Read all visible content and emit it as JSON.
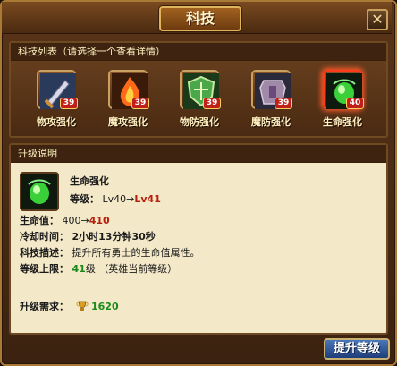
{
  "window": {
    "title": "科技",
    "close_label": "✕"
  },
  "tech_list": {
    "header": "科技列表（请选择一个查看详情）",
    "items": [
      {
        "label": "物攻强化",
        "level": "39",
        "icon": "sword-icon"
      },
      {
        "label": "魔攻强化",
        "level": "39",
        "icon": "fire-icon"
      },
      {
        "label": "物防强化",
        "level": "39",
        "icon": "shield-icon"
      },
      {
        "label": "魔防强化",
        "level": "39",
        "icon": "armor-icon"
      },
      {
        "label": "生命强化",
        "level": "40",
        "icon": "life-orb-icon"
      }
    ]
  },
  "detail": {
    "header": "升级说明",
    "name": "生命强化",
    "level_label": "等级：",
    "level_from": "Lv40",
    "level_arrow": "→",
    "level_to": "Lv41",
    "hp_label": "生命值：",
    "hp_from": "400",
    "hp_arrow": "→",
    "hp_to": "410",
    "cooldown_label": "冷却时间：",
    "cooldown_value": "2小时13分钟30秒",
    "desc_label": "科技描述：",
    "desc_value": "提升所有勇士的生命值属性。",
    "cap_label": "等级上限：",
    "cap_value": "41",
    "cap_suffix": "级 （英雄当前等级）",
    "req_label": "升级需求：",
    "req_value": "1620"
  },
  "buttons": {
    "upgrade": "提升等级"
  },
  "colors": {
    "accent_red": "#b8200e",
    "accent_green": "#1a8a1a",
    "selected_glow": "#ff5a2a"
  }
}
